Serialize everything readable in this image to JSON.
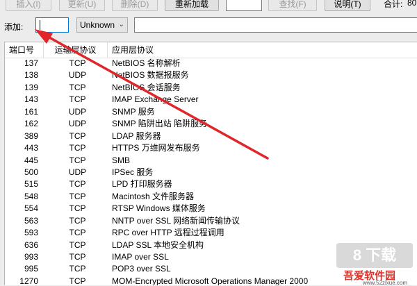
{
  "toolbar": {
    "insert_label": "插入(I)",
    "update_label": "更新(U)",
    "delete_label": "删除(D)",
    "reload_label": "重新加载",
    "find_label": "查找(F)",
    "help_label": "说明(T)",
    "total_label": "合计:",
    "total_value": "80"
  },
  "add_row": {
    "label": "添加:",
    "port_value": "",
    "protocol_selected": "Unknown",
    "description_value": ""
  },
  "table": {
    "headers": {
      "port": "端口号",
      "transport": "运输层协议",
      "application": "应用层协议"
    },
    "rows": [
      {
        "port": "137",
        "transport": "TCP",
        "application": "NetBIOS 名称解析"
      },
      {
        "port": "138",
        "transport": "UDP",
        "application": "NetBIOS 数据报服务"
      },
      {
        "port": "139",
        "transport": "TCP",
        "application": "NetBIOS 会话服务"
      },
      {
        "port": "143",
        "transport": "TCP",
        "application": "IMAP Exchange Server"
      },
      {
        "port": "161",
        "transport": "UDP",
        "application": "SNMP 服务"
      },
      {
        "port": "162",
        "transport": "UDP",
        "application": "SNMP 陷阱出站 陷阱服务"
      },
      {
        "port": "389",
        "transport": "TCP",
        "application": "LDAP 服务器"
      },
      {
        "port": "443",
        "transport": "TCP",
        "application": "HTTPS 万维网发布服务"
      },
      {
        "port": "445",
        "transport": "TCP",
        "application": "SMB"
      },
      {
        "port": "500",
        "transport": "UDP",
        "application": "IPSec 服务"
      },
      {
        "port": "515",
        "transport": "TCP",
        "application": "LPD 打印服务器"
      },
      {
        "port": "548",
        "transport": "TCP",
        "application": "Macintosh 文件服务器"
      },
      {
        "port": "554",
        "transport": "TCP",
        "application": "RTSP Windows 媒体服务"
      },
      {
        "port": "563",
        "transport": "TCP",
        "application": "NNTP over SSL 网络新闻传输协议"
      },
      {
        "port": "593",
        "transport": "TCP",
        "application": "RPC over HTTP 远程过程调用"
      },
      {
        "port": "636",
        "transport": "TCP",
        "application": "LDAP SSL 本地安全机构"
      },
      {
        "port": "993",
        "transport": "TCP",
        "application": "IMAP over SSL"
      },
      {
        "port": "995",
        "transport": "TCP",
        "application": "POP3 over SSL"
      },
      {
        "port": "1270",
        "transport": "TCP",
        "application": "MOM-Encrypted Microsoft Operations Manager 2000"
      }
    ]
  },
  "watermark": {
    "badge": "8 下载",
    "name": "吾爱软件园",
    "site": "www.52zixue.com"
  },
  "colors": {
    "arrow": "#e0252b",
    "focus_border": "#0078d7"
  }
}
